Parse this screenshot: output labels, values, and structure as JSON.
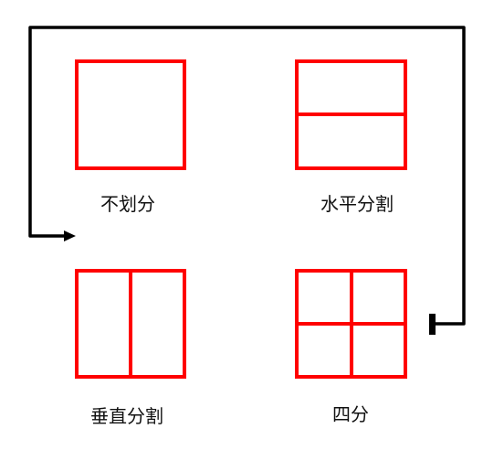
{
  "colors": {
    "box": "#ff0000",
    "path": "#000000"
  },
  "panels": [
    {
      "label": "不划分",
      "division": "none"
    },
    {
      "label": "水平分割",
      "division": "horizontal"
    },
    {
      "label": "垂直分割",
      "division": "vertical"
    },
    {
      "label": "四分",
      "division": "quad"
    }
  ]
}
